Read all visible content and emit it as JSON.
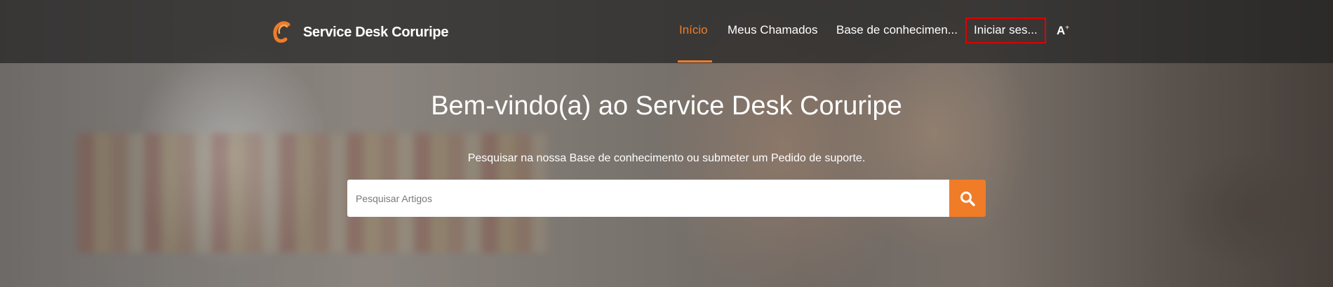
{
  "header": {
    "brand_name": "Service Desk Coruripe",
    "logo_icon": "coruripe-logo-icon"
  },
  "nav": {
    "items": [
      {
        "label": "Início",
        "active": true
      },
      {
        "label": "Meus Chamados",
        "active": false
      },
      {
        "label": "Base de conhecimen...",
        "active": false
      },
      {
        "label": "Iniciar ses...",
        "active": false
      }
    ],
    "font_size_toggle": "A",
    "font_size_toggle_sup": "+"
  },
  "hero": {
    "title": "Bem-vindo(a) ao Service Desk Coruripe",
    "subtitle": "Pesquisar na nossa Base de conhecimento ou submeter um Pedido de suporte."
  },
  "search": {
    "placeholder": "Pesquisar Artigos",
    "value": "",
    "button_icon": "search-icon"
  },
  "colors": {
    "accent": "#f07c28",
    "highlight_border": "#e00000",
    "text": "#ffffff"
  }
}
